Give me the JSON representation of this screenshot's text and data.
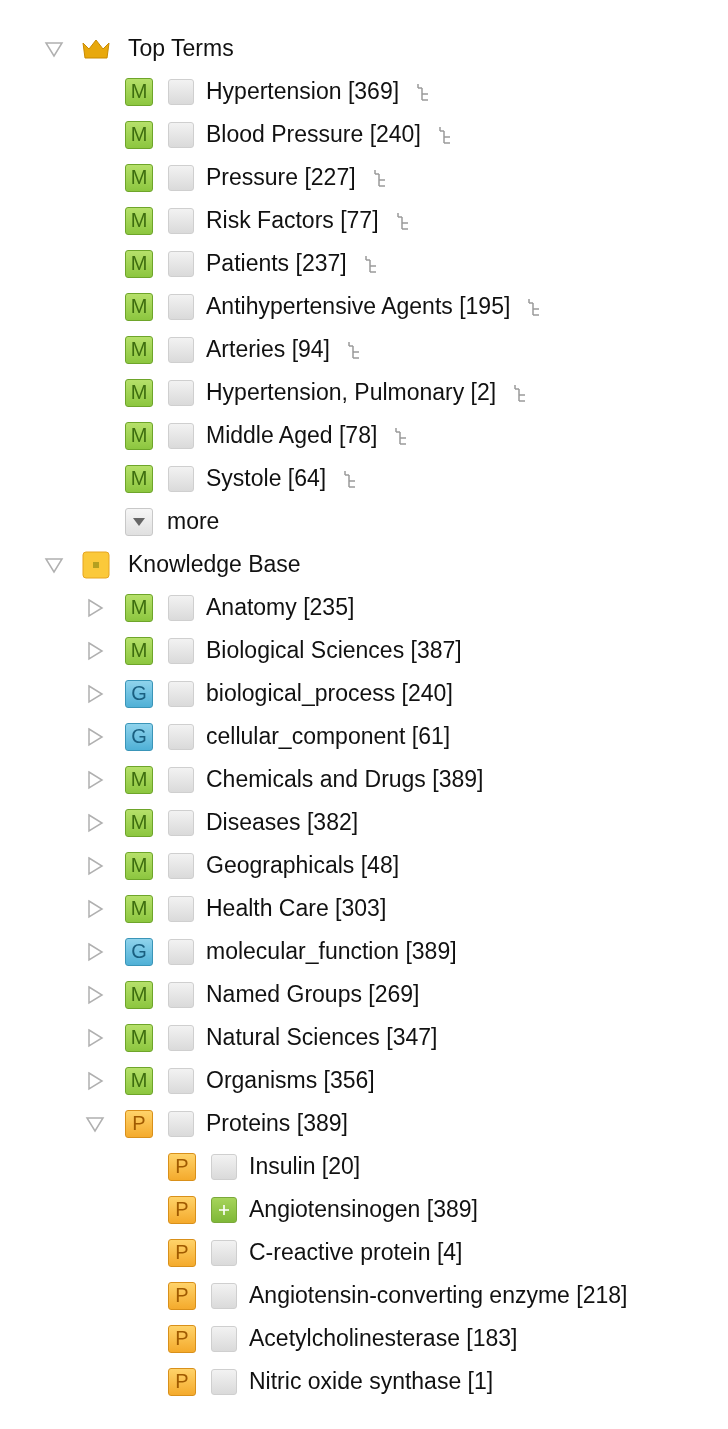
{
  "sections": [
    {
      "title": "Top Terms",
      "kind": "crown",
      "expanded": true,
      "children": [
        {
          "kind": "mesh",
          "badge": "M",
          "label": "Hypertension [369]",
          "included": false,
          "hierarchy": true
        },
        {
          "kind": "mesh",
          "badge": "M",
          "label": "Blood Pressure [240]",
          "included": false,
          "hierarchy": true
        },
        {
          "kind": "mesh",
          "badge": "M",
          "label": "Pressure [227]",
          "included": false,
          "hierarchy": true
        },
        {
          "kind": "mesh",
          "badge": "M",
          "label": "Risk Factors [77]",
          "included": false,
          "hierarchy": true
        },
        {
          "kind": "mesh",
          "badge": "M",
          "label": "Patients [237]",
          "included": false,
          "hierarchy": true
        },
        {
          "kind": "mesh",
          "badge": "M",
          "label": "Antihypertensive Agents [195]",
          "included": false,
          "hierarchy": true
        },
        {
          "kind": "mesh",
          "badge": "M",
          "label": "Arteries [94]",
          "included": false,
          "hierarchy": true
        },
        {
          "kind": "mesh",
          "badge": "M",
          "label": "Hypertension, Pulmonary [2]",
          "included": false,
          "hierarchy": true
        },
        {
          "kind": "mesh",
          "badge": "M",
          "label": "Middle Aged [78]",
          "included": false,
          "hierarchy": true
        },
        {
          "kind": "mesh",
          "badge": "M",
          "label": "Systole [64]",
          "included": false,
          "hierarchy": true
        },
        {
          "kind": "more",
          "label": "more"
        }
      ]
    },
    {
      "title": "Knowledge Base",
      "kind": "base",
      "expanded": true,
      "children": [
        {
          "kind": "mesh",
          "badge": "M",
          "label": "Anatomy [235]",
          "included": false,
          "expanded": false
        },
        {
          "kind": "mesh",
          "badge": "M",
          "label": "Biological Sciences [387]",
          "included": false,
          "expanded": false
        },
        {
          "kind": "go",
          "badge": "G",
          "label": "biological_process [240]",
          "included": false,
          "expanded": false
        },
        {
          "kind": "go",
          "badge": "G",
          "label": "cellular_component [61]",
          "included": false,
          "expanded": false
        },
        {
          "kind": "mesh",
          "badge": "M",
          "label": "Chemicals and Drugs [389]",
          "included": false,
          "expanded": false
        },
        {
          "kind": "mesh",
          "badge": "M",
          "label": "Diseases [382]",
          "included": false,
          "expanded": false
        },
        {
          "kind": "mesh",
          "badge": "M",
          "label": "Geographicals [48]",
          "included": false,
          "expanded": false
        },
        {
          "kind": "mesh",
          "badge": "M",
          "label": "Health Care [303]",
          "included": false,
          "expanded": false
        },
        {
          "kind": "go",
          "badge": "G",
          "label": "molecular_function [389]",
          "included": false,
          "expanded": false
        },
        {
          "kind": "mesh",
          "badge": "M",
          "label": "Named Groups [269]",
          "included": false,
          "expanded": false
        },
        {
          "kind": "mesh",
          "badge": "M",
          "label": "Natural Sciences [347]",
          "included": false,
          "expanded": false
        },
        {
          "kind": "mesh",
          "badge": "M",
          "label": "Organisms [356]",
          "included": false,
          "expanded": false
        },
        {
          "kind": "protein",
          "badge": "P",
          "label": "Proteins [389]",
          "included": false,
          "expanded": true,
          "children": [
            {
              "kind": "protein",
              "badge": "P",
              "label": "Insulin [20]",
              "included": false
            },
            {
              "kind": "protein",
              "badge": "P",
              "label": "Angiotensinogen [389]",
              "included": true
            },
            {
              "kind": "protein",
              "badge": "P",
              "label": "C-reactive protein [4]",
              "included": false
            },
            {
              "kind": "protein",
              "badge": "P",
              "label": "Angiotensin-converting enzyme [218]",
              "included": false
            },
            {
              "kind": "protein",
              "badge": "P",
              "label": "Acetylcholinesterase [183]",
              "included": false
            },
            {
              "kind": "protein",
              "badge": "P",
              "label": "Nitric oxide synthase [1]",
              "included": false
            }
          ]
        }
      ]
    }
  ]
}
